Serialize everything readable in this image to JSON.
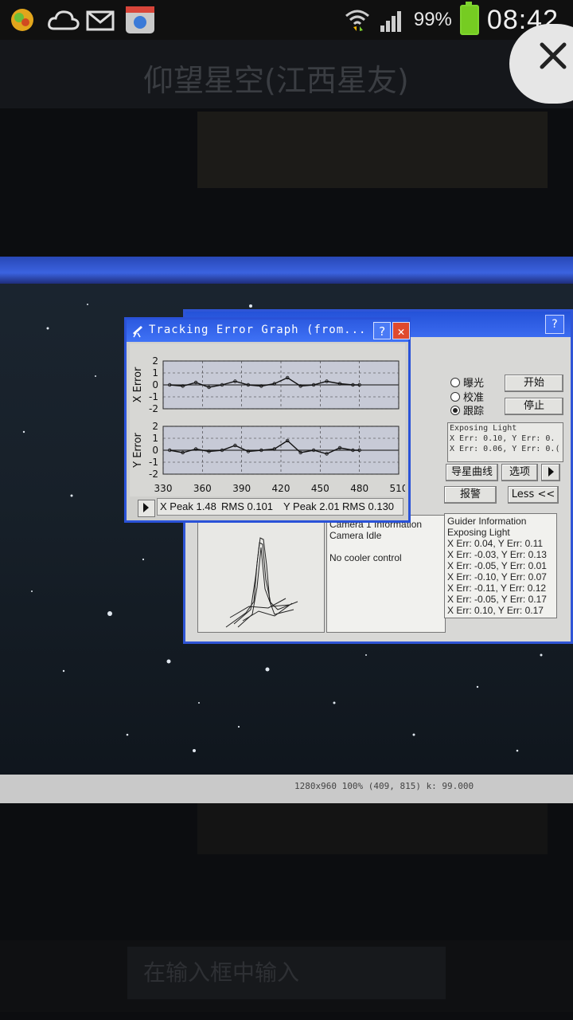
{
  "status_bar": {
    "icons": [
      "app-icon",
      "cloud-icon",
      "mail-icon",
      "phone-app-icon",
      "wifi-icon",
      "signal-icon",
      "battery-icon"
    ],
    "battery_percent": "99%",
    "time": "08:42"
  },
  "chat": {
    "title": "仰望星空(江西星友)",
    "input_placeholder": "在输入框中输入"
  },
  "tracking_window": {
    "title": "Tracking Error Graph (from...",
    "help_label": "?",
    "close_label": "✕",
    "x_axis_label": "X Error",
    "y_axis_label": "Y Error",
    "y_ticks": [
      "2",
      "1",
      "0",
      "-1",
      "-2"
    ],
    "x_ticks": [
      "330",
      "360",
      "390",
      "420",
      "450",
      "480",
      "510"
    ],
    "footer": {
      "x_peak": "X Peak 1.48",
      "x_rms": "RMS 0.101",
      "y_peak": "Y Peak 2.01",
      "y_rms": "RMS 0.130"
    }
  },
  "chart_data": [
    {
      "type": "line",
      "title": "",
      "ylabel": "X Error",
      "xlim": [
        330,
        510
      ],
      "ylim": [
        -2,
        2
      ],
      "x": [
        335,
        345,
        355,
        365,
        375,
        385,
        395,
        405,
        415,
        425,
        435,
        445,
        455,
        465,
        475,
        480
      ],
      "series": [
        {
          "values": [
            0.0,
            -0.1,
            0.2,
            -0.2,
            0.0,
            0.3,
            0.0,
            -0.1,
            0.1,
            0.6,
            -0.1,
            0.0,
            0.3,
            0.1,
            0.0,
            0.0
          ]
        }
      ]
    },
    {
      "type": "line",
      "title": "",
      "ylabel": "Y Error",
      "xlim": [
        330,
        510
      ],
      "ylim": [
        -2,
        2
      ],
      "x": [
        335,
        345,
        355,
        365,
        375,
        385,
        395,
        405,
        415,
        425,
        435,
        445,
        455,
        465,
        475,
        480
      ],
      "series": [
        {
          "values": [
            0.0,
            -0.2,
            0.1,
            -0.1,
            0.0,
            0.4,
            -0.1,
            0.0,
            0.1,
            0.8,
            -0.2,
            0.0,
            -0.3,
            0.2,
            0.0,
            0.0
          ]
        }
      ]
    }
  ],
  "main_window": {
    "help_label": "?",
    "radio_items": [
      {
        "label": "曝光",
        "selected": false
      },
      {
        "label": "校准",
        "selected": false
      },
      {
        "label": "跟踪",
        "selected": true
      }
    ],
    "start_button": "开始",
    "stop_button": "停止",
    "exposing_light_lines": [
      "Exposing Light",
      "X Err: 0.10, Y Err: 0.",
      "X Err: 0.06, Y Err: 0.("
    ],
    "guide_curve_button": "导星曲线",
    "options_button": "选项",
    "alarm_button": "报警",
    "less_button": "Less <<",
    "camera_info": {
      "title": "Camera 1 Information",
      "status": "Camera Idle",
      "cooler": "No cooler control"
    },
    "guider_info": {
      "title": "Guider Information",
      "status": "Exposing Light",
      "lines": [
        "X Err: 0.04, Y Err: 0.11",
        "X Err: -0.03, Y Err: 0.13",
        "X Err: -0.05, Y Err: 0.01",
        "X Err: -0.10, Y Err: 0.07",
        "X Err: -0.11, Y Err: 0.12",
        "X Err: -0.05, Y Err: 0.17",
        "X Err: 0.10, Y Err: 0.17"
      ]
    }
  },
  "screen_status": "1280x960    100%    (409, 815)        k: 99.000"
}
